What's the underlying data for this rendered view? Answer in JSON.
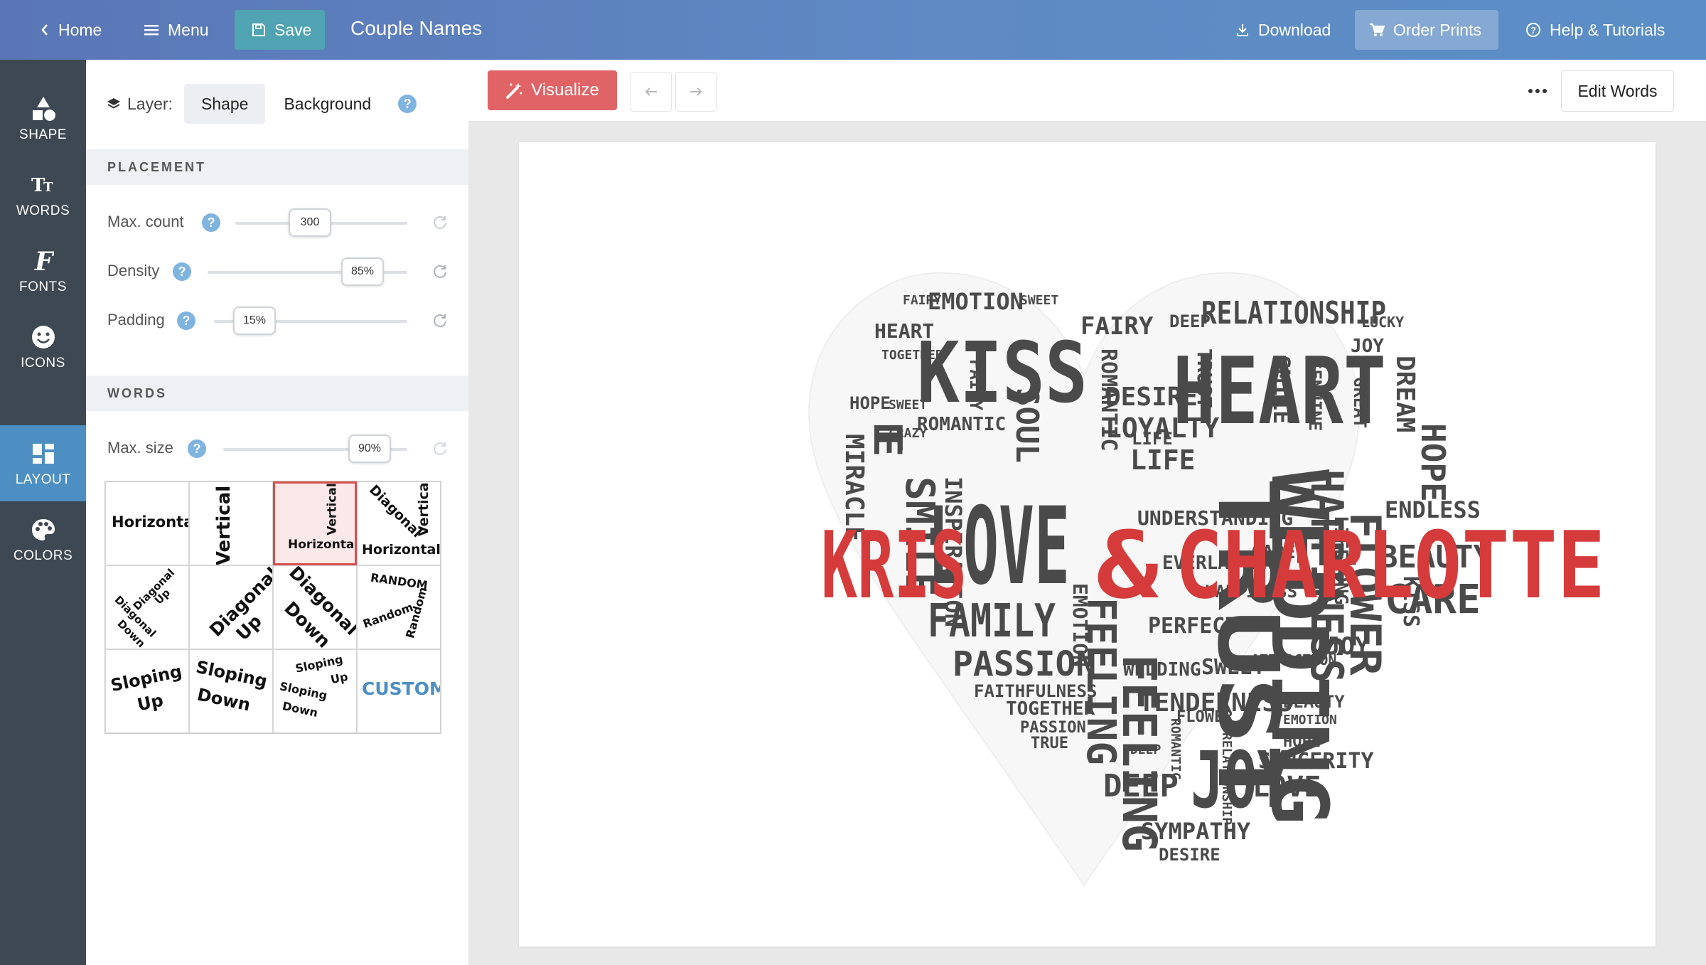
{
  "topbar": {
    "home_label": "Home",
    "menu_label": "Menu",
    "save_label": "Save",
    "title": "Couple Names",
    "download_label": "Download",
    "order_label": "Order Prints",
    "help_label": "Help & Tutorials"
  },
  "rail": {
    "items": [
      {
        "label": "SHAPE",
        "icon": "shapes-icon"
      },
      {
        "label": "WORDS",
        "icon": "text-icon"
      },
      {
        "label": "FONTS",
        "icon": "font-icon"
      },
      {
        "label": "ICONS",
        "icon": "smiley-icon"
      },
      {
        "label": "LAYOUT",
        "icon": "layout-icon",
        "active": true
      },
      {
        "label": "COLORS",
        "icon": "palette-icon"
      }
    ]
  },
  "panel": {
    "layer_label": "Layer:",
    "layer_shape": "Shape",
    "layer_background": "Background",
    "placement_head": "PLACEMENT",
    "max_count_label": "Max. count",
    "max_count_value": "300",
    "density_label": "Density",
    "density_value": "85%",
    "padding_label": "Padding",
    "padding_value": "15%",
    "words_head": "WORDS",
    "max_size_label": "Max. size",
    "max_size_value": "90%",
    "layouts": {
      "horizontal": "Horizontal",
      "vertical": "Vertical",
      "diagonal": "Diagonal",
      "up": "Up",
      "down": "Down",
      "random_caps": "RANDOM",
      "random": "Random",
      "sloping": "Sloping",
      "custom": "CUSTOM"
    },
    "selected_layout": "Horizontal + Vertical"
  },
  "workspace": {
    "visualize_label": "Visualize",
    "edit_words_label": "Edit Words"
  },
  "cloud": {
    "name1": "KRIS",
    "amp": "&",
    "name2": "CHARLOTTE",
    "words": {
      "kiss": "KISS",
      "heart": "HEART",
      "love": "LOVE",
      "trust": "TRUST",
      "wedding": "WEDDING",
      "happiness": "HAPPINESS",
      "flower": "FLOWER",
      "family": "FAMILY",
      "passion": "PASSION",
      "joy": "JOY",
      "hope": "HOPE",
      "beauty": "BEAUTY",
      "care": "CARE",
      "smile": "SMILE",
      "relationship": "RELATIONSHIP",
      "emotion": "EMOTION",
      "feeling": "FEELING",
      "tenderness": "TENDERNESS",
      "miracle": "MIRACLE",
      "soul": "SOUL",
      "forever": "FOREVER",
      "deep": "DEEP",
      "romantic": "ROMANTIC",
      "fairy": "FAIRY",
      "desire": "DESIRE",
      "loyalty": "LOYALTY",
      "sympathy": "SYMPATHY",
      "sincerity": "SINCERITY",
      "understanding": "UNDERSTANDING",
      "everlasting": "EVERLASTING",
      "perfect": "PERFECT",
      "together": "TOGETHER",
      "dream": "DREAM",
      "life": "LIFE",
      "lucky": "LUCKY",
      "genuine": "GENUINE",
      "lifelong": "LIFELONG",
      "endless": "ENDLESS",
      "inspiration": "INSPIRATION",
      "true": "TRUE",
      "attraction": "ATTRACTION",
      "romance": "ROMANCE",
      "faithfulness": "FAITHFULNESS",
      "crazy": "CRAZY",
      "sweet": "SWEET",
      "great": "GREAT",
      "relationship_small": "RELATIONSHIP"
    }
  },
  "colors": {
    "accent_red": "#d63b3b",
    "word_gray": "#4a4a4a",
    "rail_bg": "#3d4852",
    "rail_active": "#4d8fc2",
    "visualize_bg": "#e06366"
  }
}
